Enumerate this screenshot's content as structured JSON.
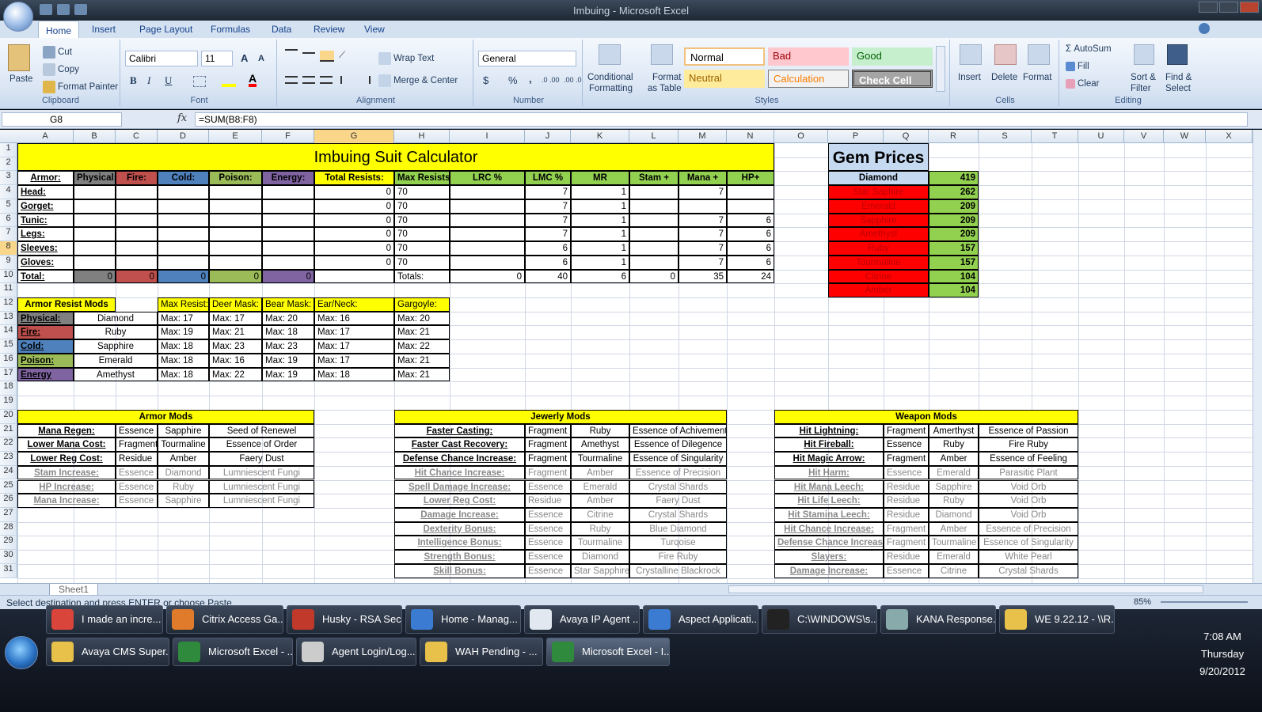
{
  "window": {
    "title": "Imbuing - Microsoft Excel"
  },
  "ribbon_tabs": [
    "Home",
    "Insert",
    "Page Layout",
    "Formulas",
    "Data",
    "Review",
    "View"
  ],
  "clipboard": {
    "paste": "Paste",
    "cut": "Cut",
    "copy": "Copy",
    "format_painter": "Format Painter",
    "label": "Clipboard"
  },
  "font": {
    "name": "Calibri",
    "size": "11",
    "label": "Font",
    "bold": "B",
    "italic": "I",
    "underline": "U",
    "grow": "A",
    "shrink": "A",
    "color_letter": "A"
  },
  "alignment": {
    "wrap": "Wrap Text",
    "merge": "Merge & Center",
    "label": "Alignment"
  },
  "number": {
    "format": "General",
    "currency": "$",
    "percent": "%",
    "comma": ",",
    "inc_dec": ".0 .00",
    "dec_dec": ".00 .0",
    "label": "Number"
  },
  "styles": {
    "conditional": "Conditional",
    "conditional2": "Formatting",
    "format_table": "Format",
    "format_table2": "as Table",
    "normal": "Normal",
    "bad": "Bad",
    "good": "Good",
    "neutral": "Neutral",
    "calculation": "Calculation",
    "check": "Check Cell",
    "label": "Styles"
  },
  "cells": {
    "insert": "Insert",
    "delete": "Delete",
    "format": "Format",
    "label": "Cells"
  },
  "editing": {
    "autosum": "AutoSum",
    "fill": "Fill",
    "clear": "Clear",
    "sort": "Sort &",
    "sort2": "Filter",
    "find": "Find &",
    "find2": "Select",
    "label": "Editing"
  },
  "formula_bar": {
    "name_box": "G8",
    "fx": "fx",
    "formula": "=SUM(B8:F8)"
  },
  "columns": [
    "A",
    "B",
    "C",
    "D",
    "E",
    "F",
    "G",
    "H",
    "I",
    "J",
    "K",
    "L",
    "M",
    "N",
    "O",
    "P",
    "Q",
    "R",
    "S",
    "T",
    "U",
    "V",
    "W",
    "X"
  ],
  "rows": [
    "1",
    "2",
    "3",
    "4",
    "5",
    "6",
    "7",
    "8",
    "9",
    "10",
    "11",
    "12",
    "13",
    "14",
    "15",
    "16",
    "17",
    "18",
    "19",
    "20",
    "21",
    "22",
    "23",
    "24",
    "25",
    "26",
    "27",
    "28",
    "29",
    "30",
    "31"
  ],
  "sheet": {
    "title": "Imbuing Suit Calculator",
    "headers": [
      "Armor:",
      "Physical:",
      "Fire:",
      "Cold:",
      "Poison:",
      "Energy:",
      "Total Resists:",
      "Max Resists:",
      "LRC %",
      "LMC %",
      "MR",
      "Stam +",
      "Mana +",
      "HP+"
    ],
    "armor_rows": [
      {
        "name": "Head:",
        "total": "0",
        "max": "70",
        "lmc": "7",
        "mr": "1",
        "stam": "",
        "mana": "7",
        "hp": ""
      },
      {
        "name": "Gorget:",
        "total": "0",
        "max": "70",
        "lmc": "7",
        "mr": "1",
        "stam": "",
        "mana": "",
        "hp": ""
      },
      {
        "name": "Tunic:",
        "total": "0",
        "max": "70",
        "lmc": "7",
        "mr": "1",
        "stam": "",
        "mana": "7",
        "hp": "6"
      },
      {
        "name": "Legs:",
        "total": "0",
        "max": "70",
        "lmc": "7",
        "mr": "1",
        "stam": "",
        "mana": "7",
        "hp": "6"
      },
      {
        "name": "Sleeves:",
        "total": "0",
        "max": "70",
        "lmc": "6",
        "mr": "1",
        "stam": "",
        "mana": "7",
        "hp": "6"
      },
      {
        "name": "Gloves:",
        "total": "0",
        "max": "70",
        "lmc": "6",
        "mr": "1",
        "stam": "",
        "mana": "7",
        "hp": "6"
      }
    ],
    "totals": {
      "label": "Total:",
      "phys": "0",
      "fire": "0",
      "cold": "0",
      "poison": "0",
      "energy": "0",
      "totals_label": "Totals:",
      "lrc": "0",
      "lmc": "40",
      "mr": "6",
      "stam": "0",
      "mana": "35",
      "hp": "24"
    },
    "gem_title": "Gem Prices",
    "gems": [
      {
        "name": "Diamond",
        "price": "419"
      },
      {
        "name": "Star Saphire",
        "price": "262"
      },
      {
        "name": "Emerald",
        "price": "209"
      },
      {
        "name": "Sapphire",
        "price": "209"
      },
      {
        "name": "Amethyst",
        "price": "209"
      },
      {
        "name": "Ruby",
        "price": "157"
      },
      {
        "name": "Tourmaline",
        "price": "157"
      },
      {
        "name": "Citrine",
        "price": "104"
      },
      {
        "name": "Amber",
        "price": "104"
      }
    ],
    "resist_headers": [
      "Armor Resist Mods",
      "Max Resist:",
      "Deer Mask:",
      "Bear Mask:",
      "Ear/Neck:",
      "Gargoyle:"
    ],
    "resist_rows": [
      {
        "type": "Physical:",
        "gem": "Diamond",
        "v": [
          "Max: 17",
          "Max: 17",
          "Max: 20",
          "Max: 16",
          "Max: 20"
        ]
      },
      {
        "type": "Fire:",
        "gem": "Ruby",
        "v": [
          "Max: 19",
          "Max: 21",
          "Max: 18",
          "Max: 17",
          "Max: 21"
        ]
      },
      {
        "type": "Cold:",
        "gem": "Sapphire",
        "v": [
          "Max: 18",
          "Max: 23",
          "Max: 23",
          "Max: 17",
          "Max: 22"
        ]
      },
      {
        "type": "Poison:",
        "gem": "Emerald",
        "v": [
          "Max: 18",
          "Max: 16",
          "Max: 19",
          "Max: 17",
          "Max: 21"
        ]
      },
      {
        "type": "Energy",
        "gem": "Amethyst",
        "v": [
          "Max: 18",
          "Max: 22",
          "Max: 19",
          "Max: 18",
          "Max: 21"
        ]
      }
    ],
    "armor_mods": {
      "title": "Armor Mods",
      "rows": [
        [
          "Mana Regen:",
          "Essence",
          "Sapphire",
          "Seed of Renewel"
        ],
        [
          "Lower Mana Cost:",
          "Fragment",
          "Tourmaline",
          "Essence of Order"
        ],
        [
          "Lower Reg Cost:",
          "Residue",
          "Amber",
          "Faery Dust"
        ],
        [
          "Stam Increase:",
          "Essence",
          "Diamond",
          "Lumniescent Fungi"
        ],
        [
          "HP Increase:",
          "Essence",
          "Ruby",
          "Lumniescent Fungi"
        ],
        [
          "Mana Increase:",
          "Essence",
          "Sapphire",
          "Lumniescent Fungi"
        ]
      ]
    },
    "jewelry_mods": {
      "title": "Jewerly Mods",
      "rows": [
        [
          "Faster Casting:",
          "Fragment",
          "Ruby",
          "Essence of Achivement"
        ],
        [
          "Faster Cast Recovery:",
          "Fragment",
          "Amethyst",
          "Essence of Dilegence"
        ],
        [
          "Defense Chance Increase:",
          "Fragment",
          "Tourmaline",
          "Essence of Singularity"
        ],
        [
          "Hit Chance Increase:",
          "Fragment",
          "Amber",
          "Essence of Precision"
        ],
        [
          "Spell Damage Increase:",
          "Essence",
          "Emerald",
          "Crystal Shards"
        ],
        [
          "Lower Reg Cost:",
          "Residue",
          "Amber",
          "Faery Dust"
        ],
        [
          "Damage Increase:",
          "Essence",
          "Citrine",
          "Crystal Shards"
        ],
        [
          "Dexterity Bonus:",
          "Essence",
          "Ruby",
          "Blue Diamond"
        ],
        [
          "Intelligence Bonus:",
          "Essence",
          "Tourmaline",
          "Turqoise"
        ],
        [
          "Strength Bonus:",
          "Essence",
          "Diamond",
          "Fire Ruby"
        ],
        [
          "Skill Bonus:",
          "Essence",
          "Star Sapphire",
          "Crystalline Blackrock"
        ]
      ]
    },
    "weapon_mods": {
      "title": "Weapon Mods",
      "rows": [
        [
          "Hit Lightning:",
          "Fragment",
          "Amerthyst",
          "Essence of Passion"
        ],
        [
          "Hit Fireball:",
          "Essence",
          "Ruby",
          "Fire Ruby"
        ],
        [
          "Hit Magic Arrow:",
          "Fragment",
          "Amber",
          "Essence of Feeling"
        ],
        [
          "Hit Harm:",
          "Essence",
          "Emerald",
          "Parasitic Plant"
        ],
        [
          "Hit Mana Leech:",
          "Residue",
          "Sapphire",
          "Void Orb"
        ],
        [
          "Hit Life Leech:",
          "Residue",
          "Ruby",
          "Void Orb"
        ],
        [
          "Hit Stamina Leech:",
          "Residue",
          "Diamond",
          "Void Orb"
        ],
        [
          "Hit Chance Increase:",
          "Fragment",
          "Amber",
          "Essence of Precision"
        ],
        [
          "Defense Chance Increase:",
          "Fragment",
          "Tourmaline",
          "Essence of Singularity"
        ],
        [
          "Slayers:",
          "Residue",
          "Emerald",
          "White Pearl"
        ],
        [
          "Damage Increase:",
          "Essence",
          "Citrine",
          "Crystal Shards"
        ]
      ]
    }
  },
  "sheet_tab": "Sheet1",
  "status": {
    "text": "Select destination and press ENTER or choose Paste",
    "zoom": "85%"
  },
  "taskbar": {
    "row1": [
      "I made an incre...",
      "Citrix Access Ga...",
      "Husky - RSA Sec...",
      "Home - Manag...",
      "Avaya IP Agent ...",
      "Aspect Applicati...",
      "C:\\WINDOWS\\s...",
      "KANA Response...",
      "WE 9.22.12 - \\\\R..."
    ],
    "row2": [
      "Avaya CMS Super...",
      "Microsoft Excel - ...",
      "Agent Login/Log...",
      "WAH Pending - ...",
      "Microsoft Excel - I..."
    ],
    "time": "7:08 AM",
    "day": "Thursday",
    "date": "9/20/2012"
  },
  "colors": {
    "yellow": "#ffff00",
    "green": "#92d050",
    "red": "#ff0000",
    "fire": "#c0504d",
    "cold": "#4f81bd",
    "poison": "#9bbb59",
    "energy": "#8064a2",
    "lightblue": "#c5d9f1",
    "gray": "#808080"
  }
}
